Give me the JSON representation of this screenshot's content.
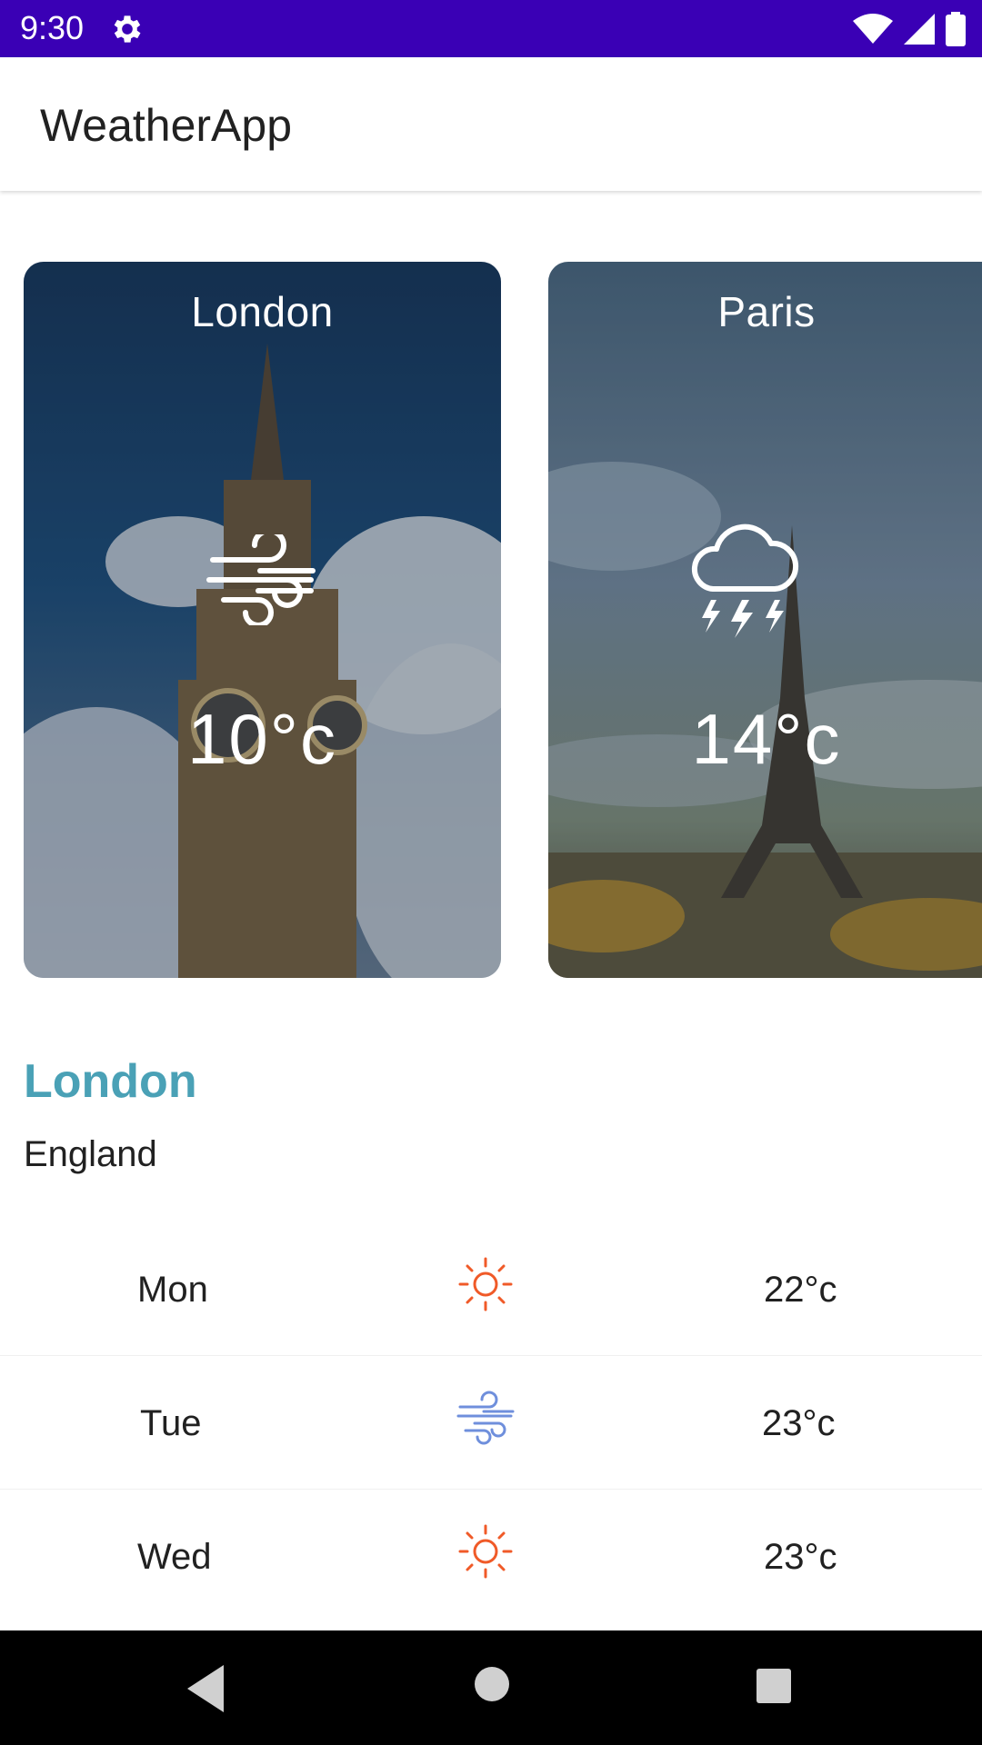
{
  "status_bar": {
    "time": "9:30",
    "background": "#3A00B5",
    "icons": [
      "gear-icon",
      "wifi-icon",
      "signal-icon",
      "battery-icon"
    ]
  },
  "app_bar": {
    "title": "WeatherApp"
  },
  "cards": [
    {
      "city": "London",
      "temperature": "10°c",
      "icon": "wind-icon"
    },
    {
      "city": "Paris",
      "temperature": "14°c",
      "icon": "thunderstorm-icon"
    }
  ],
  "selected": {
    "city": "London",
    "country": "England",
    "accent": "#4aa1b6"
  },
  "forecast": [
    {
      "day": "Mon",
      "icon": "sun-icon",
      "temperature": "22°c"
    },
    {
      "day": "Tue",
      "icon": "wind-icon",
      "temperature": "23°c"
    },
    {
      "day": "Wed",
      "icon": "sun-icon",
      "temperature": "23°c"
    }
  ],
  "nav_bar": {
    "icons": [
      "back-icon",
      "home-icon",
      "recents-icon"
    ]
  }
}
